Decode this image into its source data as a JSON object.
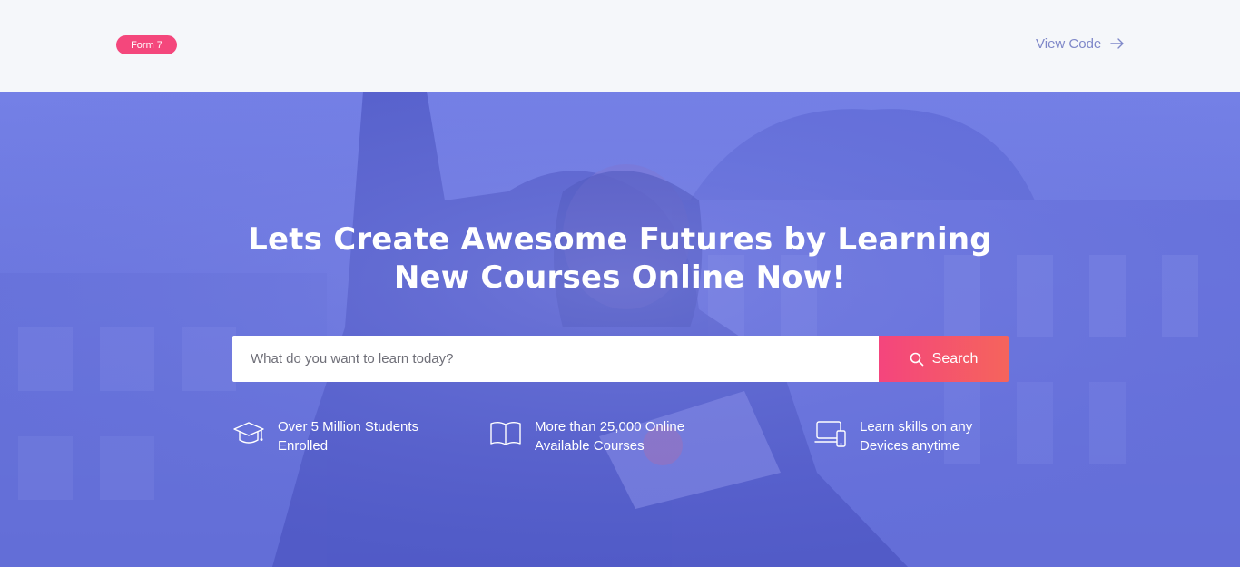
{
  "header": {
    "badge": "Form 7",
    "view_code": "View Code"
  },
  "hero": {
    "headline_line1": "Lets Create Awesome Futures by Learning",
    "headline_line2": "New Courses Online Now!",
    "search": {
      "placeholder": "What do you want to learn today?",
      "button_label": "Search"
    },
    "features": [
      {
        "icon": "graduation-cap-icon",
        "line1": "Over 5 Million Students",
        "line2": "Enrolled"
      },
      {
        "icon": "open-book-icon",
        "line1": "More than 25,000 Online",
        "line2": "Available Courses"
      },
      {
        "icon": "devices-icon",
        "line1": "Learn skills on any",
        "line2": "Devices anytime"
      }
    ]
  },
  "colors": {
    "badge": "#f4477c",
    "overlay": "#6b75e0",
    "button_start": "#f4457d",
    "button_end": "#f5645c",
    "link": "#7f88c9"
  }
}
